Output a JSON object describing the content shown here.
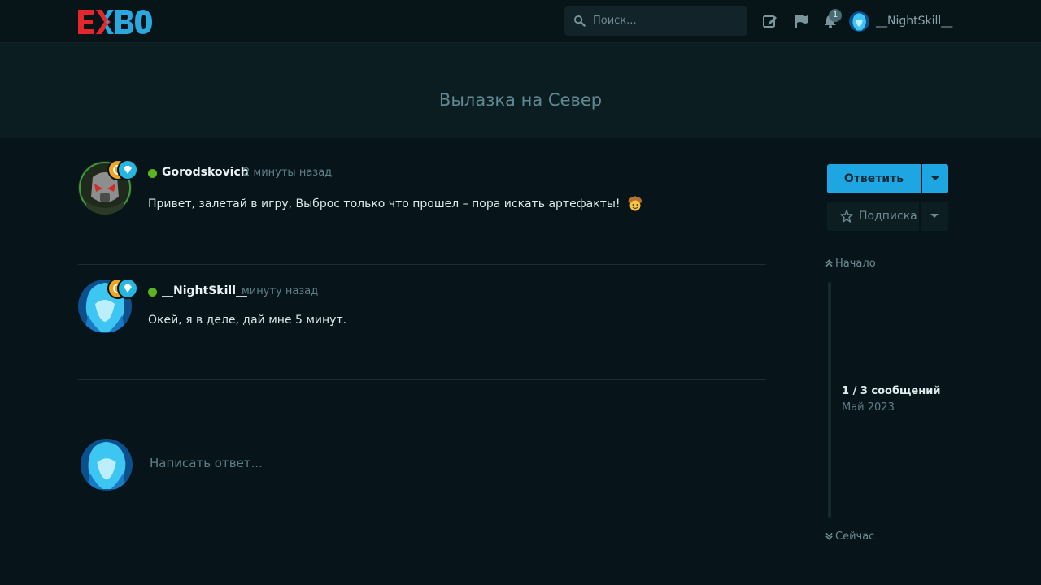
{
  "header": {
    "logo_text": "EXBO",
    "search_placeholder": "Поиск...",
    "notifications_count": "1",
    "username": "__NightSkill__"
  },
  "discussion": {
    "title": "Вылазка на Север"
  },
  "posts": [
    {
      "author": "Gorodskovich",
      "time": "2 минуты назад",
      "text": "Привет, залетай в игру, Выброс только что прошел – пора искать артефакты!",
      "emoji": "cowboy-face-emoji"
    },
    {
      "author": "__NightSkill__",
      "time": "минуту назад",
      "text": "Окей, я в деле, дай мне 5 минут."
    }
  ],
  "composer": {
    "placeholder": "Написать ответ..."
  },
  "sidebar": {
    "reply_label": "Ответить",
    "subscribe_label": "Подписка",
    "start_label": "Начало",
    "now_label": "Сейчас",
    "scrubber_count": "1 / 3 сообщений",
    "scrubber_date": "Май 2023"
  },
  "colors": {
    "background": "#07151a",
    "accent": "#1ea6e2",
    "online": "#5db220",
    "logo_red": "#e5262d",
    "logo_blue": "#2aa7df"
  }
}
